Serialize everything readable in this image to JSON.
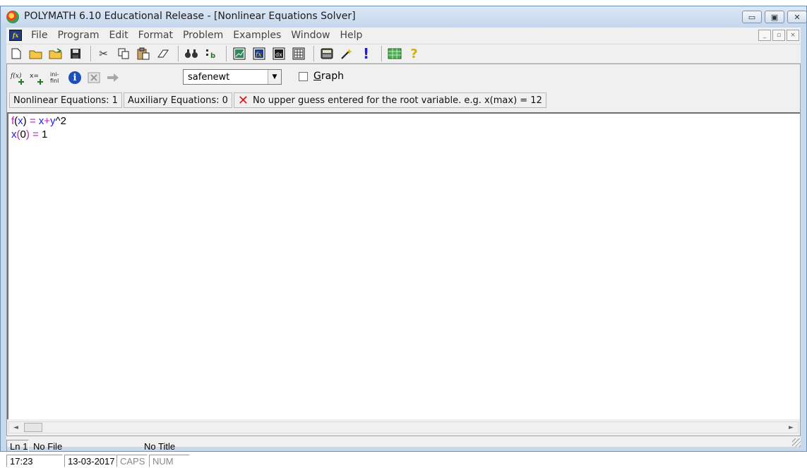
{
  "window": {
    "title": "POLYMATH 6.10 Educational Release - [Nonlinear Equations Solver]"
  },
  "caption_buttons": {
    "minimize": "▭",
    "maximize": "▣",
    "close": "✕"
  },
  "menu": {
    "items": [
      "File",
      "Program",
      "Edit",
      "Format",
      "Problem",
      "Examples",
      "Window",
      "Help"
    ],
    "mdi": {
      "minimize": "_",
      "restore": "▫",
      "close": "×"
    }
  },
  "toolbar": {
    "icons": [
      "new-file-icon",
      "open-folder-icon",
      "open-folder-alt-icon",
      "save-disk-icon",
      "cut-scissors-icon",
      "copy-icon",
      "paste-icon",
      "eraser-icon",
      "find-binoculars-icon",
      "replace-icon",
      "chart-window-icon",
      "fx-window-icon",
      "dx-window-icon",
      "table-window-icon",
      "calculator-icon",
      "magic-wand-icon",
      "exclamation-icon",
      "grid-icon",
      "help-question-icon"
    ]
  },
  "equation_panel": {
    "icon_labels": {
      "add_function": "f(x)",
      "add_equation": "x=",
      "ini_fini": "ini-\nfinl",
      "info": "i"
    },
    "solver": "safenewt",
    "graph_label_u": "G",
    "graph_label_rest": "raph"
  },
  "infobar": {
    "nonlinear": "Nonlinear Equations: 1",
    "auxiliary": "Auxiliary Equations: 0",
    "error": "No upper guess entered for the root variable. e.g. x(max) = 12"
  },
  "editor": {
    "line1": {
      "fn": "f",
      "p1": "(",
      "v": "x",
      "p2": ")",
      "eq": " = ",
      "x": "x",
      "plus": "+",
      "y": "y",
      "pow": "^2"
    },
    "line2": {
      "v": "x",
      "p1": "(",
      "n": "0",
      "p2": ")",
      "eq": " = ",
      "val": "1"
    }
  },
  "status": {
    "line": "Ln 1",
    "file": "No File",
    "title": "No Title",
    "time": "17:23",
    "date": "13-03-2017",
    "caps": "CAPS",
    "num": "NUM"
  },
  "colors": {
    "function": "#c020c0",
    "variable": "#1f1fe0",
    "error": "#d21a1a"
  }
}
